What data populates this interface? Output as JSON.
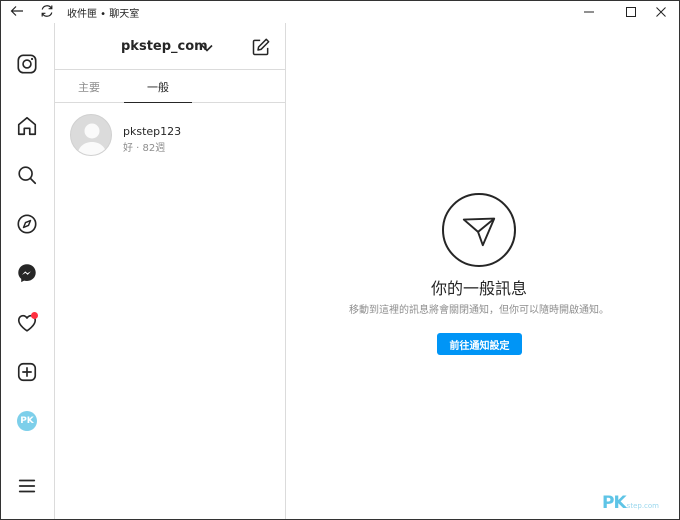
{
  "titlebar": {
    "title": "收件匣 • 聊天室"
  },
  "rail": {
    "items": [
      {
        "icon": "instagram-logo-icon"
      },
      {
        "icon": "home-icon"
      },
      {
        "icon": "search-icon"
      },
      {
        "icon": "explore-compass-icon"
      },
      {
        "icon": "messenger-icon"
      },
      {
        "icon": "heart-icon",
        "badge": true
      },
      {
        "icon": "create-plus-icon"
      },
      {
        "icon": "profile-avatar",
        "initials": "PK"
      },
      {
        "icon": "menu-icon"
      }
    ]
  },
  "list": {
    "username": "pkstep_com",
    "tabs": [
      {
        "label": "主要",
        "active": false
      },
      {
        "label": "一般",
        "active": true
      }
    ],
    "threads": [
      {
        "name": "pkstep123",
        "subtitle": "好 · 82週"
      }
    ]
  },
  "main": {
    "title": "你的一般訊息",
    "description": "移動到這裡的訊息將會關閉通知，但你可以隨時開啟通知。",
    "cta_label": "前往通知設定"
  },
  "colors": {
    "accent": "#0095f6",
    "badge": "#ff3040",
    "border": "#dbdbdb"
  },
  "watermark": {
    "brand": "PK",
    "sub": "step.com"
  }
}
